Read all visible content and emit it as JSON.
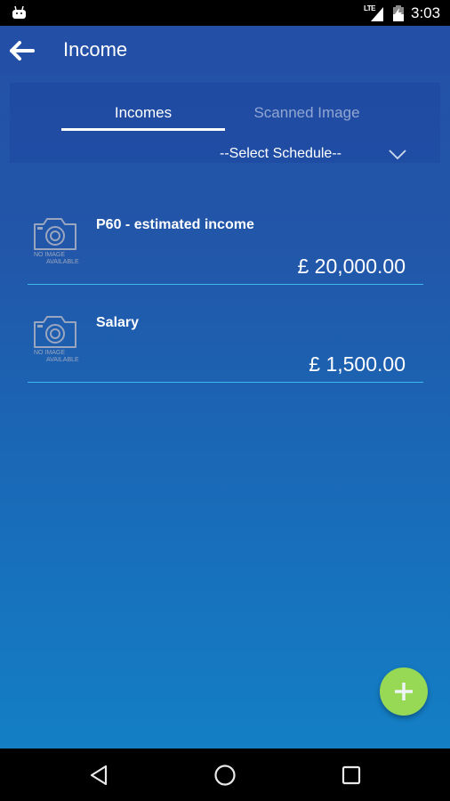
{
  "status_bar": {
    "network_label": "LTE",
    "time": "3:03",
    "icons": [
      "android-icon",
      "signal-icon",
      "battery-charging-icon"
    ]
  },
  "app_bar": {
    "title": "Income",
    "back_icon": "arrow-left-icon"
  },
  "tabs": [
    {
      "label": "Incomes",
      "active": true
    },
    {
      "label": "Scanned Image",
      "active": false
    }
  ],
  "schedule_select": {
    "value": "--Select Schedule--",
    "icon": "chevron-down-icon"
  },
  "incomes": [
    {
      "name": "P60 - estimated income",
      "amount": "£ 20,000.00",
      "thumbnail_text_1": "NO IMAGE",
      "thumbnail_text_2": "AVAILABLE"
    },
    {
      "name": "Salary",
      "amount": "£ 1,500.00",
      "thumbnail_text_1": "NO IMAGE",
      "thumbnail_text_2": "AVAILABLE"
    }
  ],
  "fab": {
    "icon": "plus-icon",
    "color": "#97d855"
  },
  "colors": {
    "app_bar": "#2350a6",
    "gradient_bottom": "#137fc5",
    "divider": "#3fb8ea"
  },
  "nav_bar": {
    "buttons": [
      "back-triangle-icon",
      "home-circle-icon",
      "recents-square-icon"
    ]
  }
}
